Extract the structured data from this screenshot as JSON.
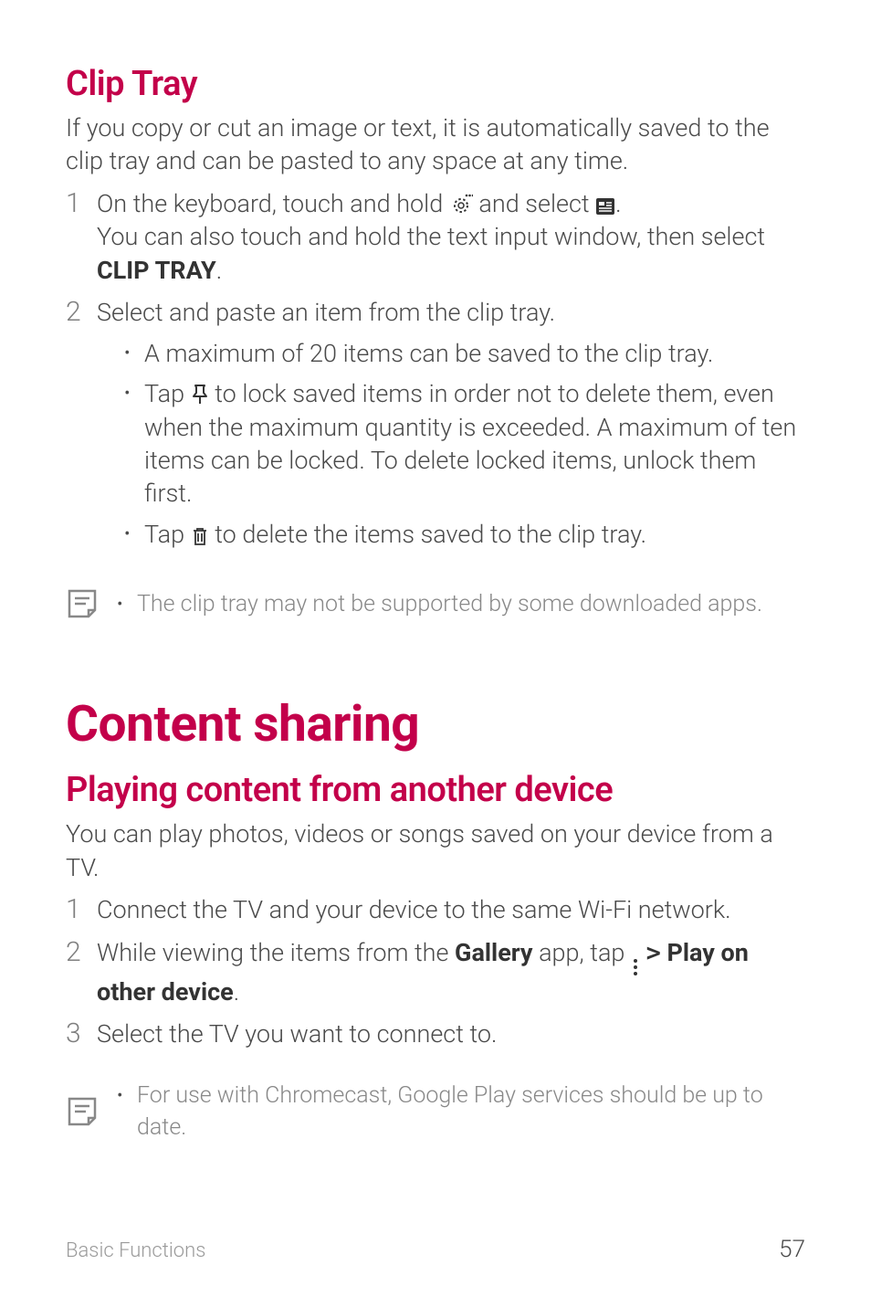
{
  "section1": {
    "heading": "Clip Tray",
    "intro": "If you copy or cut an image or text, it is automatically saved to the clip tray and can be pasted to any space at any time.",
    "step1_a": "On the keyboard, touch and hold ",
    "step1_b": " and select ",
    "step1_c": ".",
    "step1_line2_a": "You can also touch and hold the text input window, then select ",
    "step1_line2_bold": "CLIP TRAY",
    "step1_line2_b": ".",
    "step2": "Select and paste an item from the clip tray.",
    "bullet1": "A maximum of 20 items can be saved to the clip tray.",
    "bullet2_a": "Tap ",
    "bullet2_b": " to lock saved items in order not to delete them, even when the maximum quantity is exceeded. A maximum of ten items can be locked. To delete locked items, unlock them first.",
    "bullet3_a": "Tap ",
    "bullet3_b": " to delete the items saved to the clip tray.",
    "note": "The clip tray may not be supported by some downloaded apps."
  },
  "section2": {
    "heading_main": "Content sharing",
    "heading_sub": "Playing content from another device",
    "intro": "You can play photos, videos or songs saved on your device from a TV.",
    "step1": "Connect the TV and your device to the same Wi-Fi network.",
    "step2_a": "While viewing the items from the ",
    "step2_b": "Gallery",
    "step2_c": " app, tap ",
    "step2_d": "Play on other device",
    "step2_e": ".",
    "step3": "Select the TV you want to connect to.",
    "note": "For use with Chromecast, Google Play services should be up to date."
  },
  "footer": {
    "left": "Basic Functions",
    "right": "57"
  },
  "nums": {
    "n1": "1",
    "n2": "2",
    "n3": "3"
  }
}
